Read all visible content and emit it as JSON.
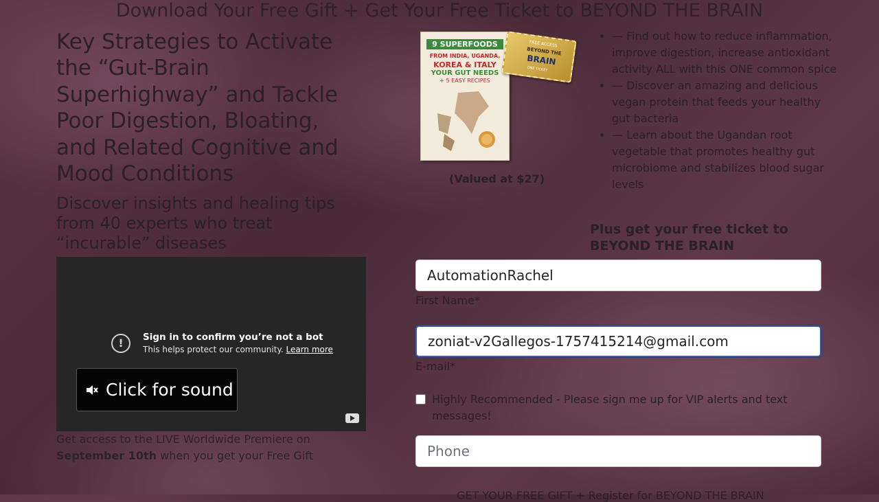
{
  "header": {
    "title": "Download Your Free Gift + Get Your Free Ticket to BEYOND THE BRAIN"
  },
  "left": {
    "headline": "Key Strategies to Activate the “Gut-Brain Superhighway” and Tackle Poor Digestion, Bloating, and Related Cognitive and Mood Conditions",
    "subhead": "Discover insights and healing tips from 40 experts who treat “incurable” diseases"
  },
  "video": {
    "bot_title": "Sign in to confirm you’re not a bot",
    "bot_sub": "This helps protect our community.",
    "learn_more": "Learn more",
    "sound_label": "Click for sound"
  },
  "premiere": {
    "before": "Get access to the LIVE Worldwide Premiere on",
    "date": "September 10th",
    "after": " when you get your Free Gift"
  },
  "product": {
    "book_line1": "9 SUPERFOODS",
    "book_line2a": "FROM INDIA, UGANDA,",
    "book_line2b": "KOREA & ITALY",
    "book_line3": "YOUR GUT NEEDS",
    "book_line4": "+ 5 EASY RECIPES",
    "ticket_top": "FREE ACCESS",
    "ticket_mid": "BEYOND THE",
    "ticket_main": "BRAIN",
    "ticket_bottom": "ONE TICKET",
    "valued": "(Valued at $27)"
  },
  "bullets": [
    "— Find out how to reduce inflammation, improve digestion, increase antioxidant activity ALL with this ONE common spice",
    "— Discover an amazing and delicious vegan protein that feeds your healthy gut bacteria",
    "— Learn about the Ugandan root vegetable that promotes healthy gut microbiome and stabilizes blood sugar levels"
  ],
  "plus_text": "Plus get your free ticket to BEYOND THE BRAIN",
  "form": {
    "first_name_value": "AutomationRachel",
    "first_name_label": "First Name*",
    "email_value": "zoniat-v2Gallegos-1757415214@gmail.com",
    "email_label": "E-mail*",
    "vip_label": "Highly Recommended - Please sign me up for VIP alerts and text messages!",
    "phone_placeholder": "Phone",
    "submit_partial": "GET YOUR FREE GIFT + Register for BEYOND THE BRAIN"
  },
  "icons": [
    "warning-icon",
    "mute-icon",
    "youtube-icon"
  ]
}
